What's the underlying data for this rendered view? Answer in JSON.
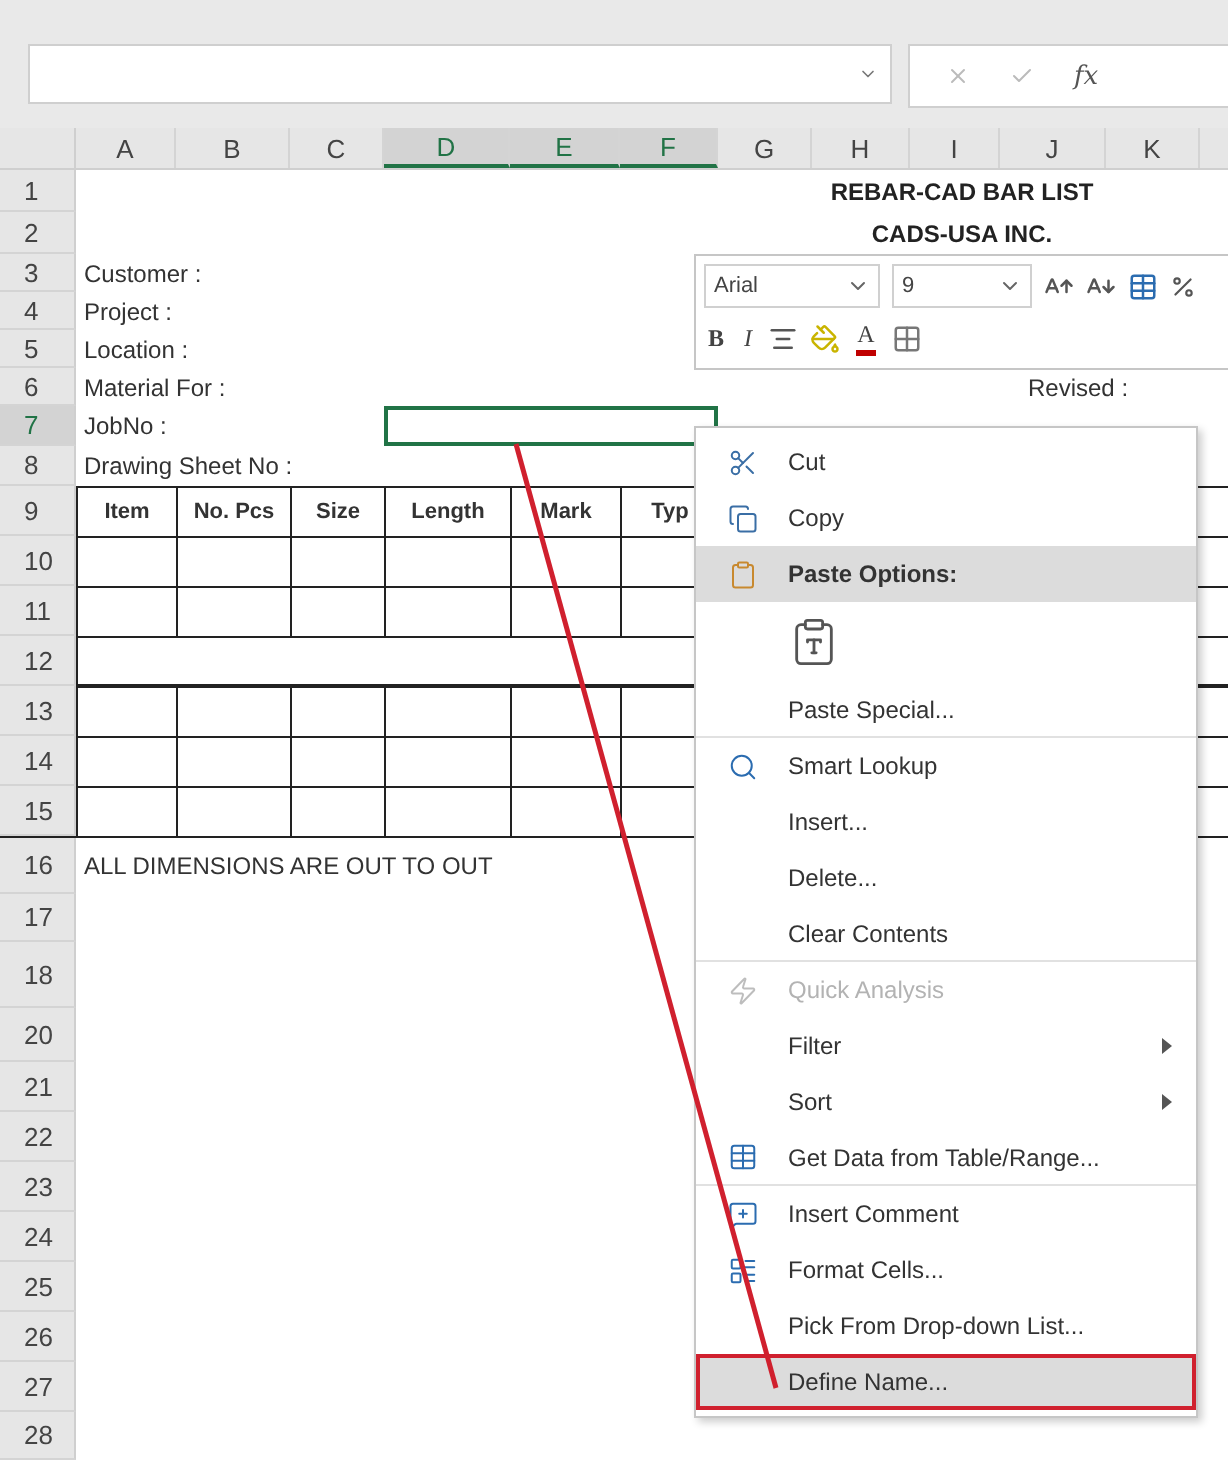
{
  "formula_bar": {
    "function_label": "fx"
  },
  "columns": [
    {
      "label": "A",
      "selected": false
    },
    {
      "label": "B",
      "selected": false
    },
    {
      "label": "C",
      "selected": false
    },
    {
      "label": "D",
      "selected": true
    },
    {
      "label": "E",
      "selected": true
    },
    {
      "label": "F",
      "selected": true
    },
    {
      "label": "G",
      "selected": false
    },
    {
      "label": "H",
      "selected": false
    },
    {
      "label": "I",
      "selected": false
    },
    {
      "label": "J",
      "selected": false
    },
    {
      "label": "K",
      "selected": false
    }
  ],
  "rows": [
    {
      "number": "1",
      "selected": false,
      "kind": "title",
      "text": "REBAR-CAD BAR LIST"
    },
    {
      "number": "2",
      "selected": false,
      "kind": "title",
      "text": "CADS-USA INC."
    },
    {
      "number": "3",
      "selected": false,
      "kind": "label",
      "text": "Customer :"
    },
    {
      "number": "4",
      "selected": false,
      "kind": "label",
      "text": "Project :"
    },
    {
      "number": "5",
      "selected": false,
      "kind": "label",
      "text": "Location :"
    },
    {
      "number": "6",
      "selected": false,
      "kind": "label",
      "text": "Material For :",
      "side_text": "Revised :"
    },
    {
      "number": "7",
      "selected": true,
      "kind": "label",
      "text": "JobNo :"
    },
    {
      "number": "8",
      "selected": false,
      "kind": "label",
      "text": "Drawing Sheet No :"
    },
    {
      "number": "9",
      "selected": false,
      "kind": "table-header",
      "cells": [
        "Item",
        "No. Pcs",
        "Size",
        "Length",
        "Mark",
        "Typ"
      ]
    },
    {
      "number": "10",
      "selected": false,
      "kind": "table-row"
    },
    {
      "number": "11",
      "selected": false,
      "kind": "table-row"
    },
    {
      "number": "12",
      "selected": false,
      "kind": "table-merged"
    },
    {
      "number": "13",
      "selected": false,
      "kind": "table-row"
    },
    {
      "number": "14",
      "selected": false,
      "kind": "table-row"
    },
    {
      "number": "15",
      "selected": false,
      "kind": "table-row"
    },
    {
      "number": "16",
      "selected": false,
      "kind": "label",
      "text": "ALL DIMENSIONS ARE OUT TO OUT"
    },
    {
      "number": "17",
      "selected": false,
      "kind": "empty"
    },
    {
      "number": "18",
      "selected": false,
      "kind": "empty"
    },
    {
      "number": "20",
      "selected": false,
      "kind": "empty"
    },
    {
      "number": "21",
      "selected": false,
      "kind": "empty"
    },
    {
      "number": "22",
      "selected": false,
      "kind": "empty"
    },
    {
      "number": "23",
      "selected": false,
      "kind": "empty"
    },
    {
      "number": "24",
      "selected": false,
      "kind": "empty"
    },
    {
      "number": "25",
      "selected": false,
      "kind": "empty"
    },
    {
      "number": "26",
      "selected": false,
      "kind": "empty"
    },
    {
      "number": "27",
      "selected": false,
      "kind": "empty"
    },
    {
      "number": "28",
      "selected": false,
      "kind": "empty"
    }
  ],
  "mini_toolbar": {
    "font": "Arial",
    "size": "9",
    "bold": "B",
    "italic": "I",
    "font_color": "A"
  },
  "context_menu": [
    {
      "kind": "cut",
      "label": "Cut",
      "selected": false,
      "disabled": false
    },
    {
      "kind": "copy",
      "label": "Copy",
      "selected": false,
      "disabled": false
    },
    {
      "kind": "paste-header",
      "label": "Paste Options:",
      "selected": true,
      "disabled": false
    },
    {
      "kind": "paste-option",
      "selected": false,
      "disabled": false
    },
    {
      "kind": "plain",
      "label": "Paste Special...",
      "selected": false,
      "disabled": false,
      "separator_after": true
    },
    {
      "kind": "lookup",
      "label": "Smart Lookup",
      "selected": false,
      "disabled": false
    },
    {
      "kind": "plain",
      "label": "Insert...",
      "selected": false,
      "disabled": false
    },
    {
      "kind": "plain",
      "label": "Delete...",
      "selected": false,
      "disabled": false
    },
    {
      "kind": "plain",
      "label": "Clear Contents",
      "selected": false,
      "disabled": false,
      "separator_after": true
    },
    {
      "kind": "analysis",
      "label": "Quick Analysis",
      "selected": false,
      "disabled": true
    },
    {
      "kind": "submenu",
      "label": "Filter",
      "selected": false,
      "disabled": false
    },
    {
      "kind": "submenu",
      "label": "Sort",
      "selected": false,
      "disabled": false
    },
    {
      "kind": "get-data",
      "label": "Get Data from Table/Range...",
      "selected": false,
      "disabled": false,
      "separator_after": true
    },
    {
      "kind": "comment",
      "label": "Insert Comment",
      "selected": false,
      "disabled": false
    },
    {
      "kind": "format",
      "label": "Format Cells...",
      "selected": false,
      "disabled": false
    },
    {
      "kind": "plain",
      "label": "Pick From Drop-down List...",
      "selected": false,
      "disabled": false
    },
    {
      "kind": "plain",
      "label": "Define Name...",
      "selected": true,
      "disabled": false,
      "highlighted": true
    }
  ]
}
